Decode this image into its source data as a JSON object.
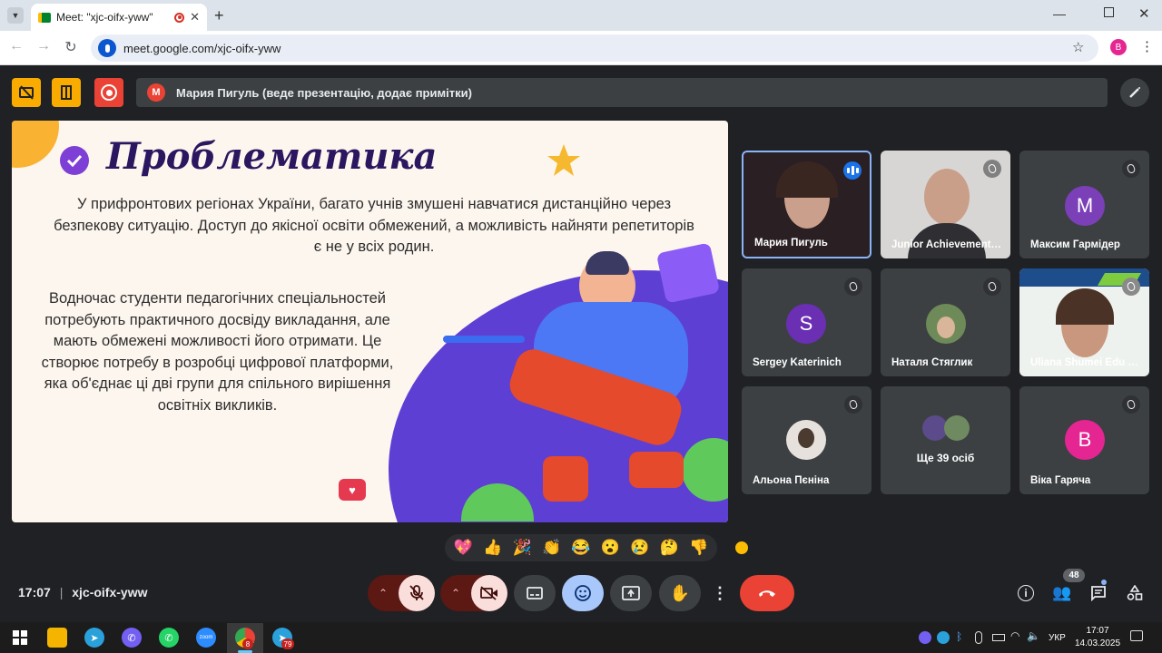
{
  "browser": {
    "tab_title": "Meet: \"xjc-oifx-yww\"",
    "url": "meet.google.com/xjc-oifx-yww",
    "profile_initial": "B"
  },
  "meet": {
    "presenter_initial": "M",
    "presenter_banner": "Мария Пигуль (веде презентацію, додає примітки)",
    "time": "17:07",
    "separator": "|",
    "meeting_code": "xjc-oifx-yww",
    "people_count": "48"
  },
  "slide": {
    "title": "Проблематика",
    "paragraph1": "У прифронтових регіонах України, багато учнів змушені навчатися дистанційно через безпекову ситуацію. Доступ до якісної освіти обмежений, а можливість найняти репетиторів є не у всіх родин.",
    "paragraph2": "Водночас студенти педагогічних спеціальностей потребують практичного досвіду викладання, але мають обмежені можливості його отримати. Це створює потребу в розробці цифрової платформи, яка об'єднає ці дві групи для спільного вирішення освітніх викликів."
  },
  "participants": [
    {
      "name": "Мария Пигуль",
      "type": "video",
      "speaking": true
    },
    {
      "name": "Junior Achievement Ukraine",
      "type": "video",
      "muted": true
    },
    {
      "name": "Максим Гармідер",
      "type": "avatar",
      "initial": "M",
      "color": "#7b3fb8",
      "muted": true
    },
    {
      "name": "Sergey Katerinich",
      "type": "avatar",
      "initial": "S",
      "color": "#6a2fb3",
      "muted": true
    },
    {
      "name": "Наталя Стяглик",
      "type": "photo",
      "muted": true
    },
    {
      "name": "Uliana Shumei Edu Hub",
      "type": "video",
      "muted": true
    },
    {
      "name": "Альона Пєніна",
      "type": "photo",
      "muted": true
    },
    {
      "name": "Ще 39 осіб",
      "type": "others"
    },
    {
      "name": "Віка Гаряча",
      "type": "avatar",
      "initial": "B",
      "color": "#e52592",
      "muted": true
    }
  ],
  "reactions": [
    "💖",
    "👍",
    "🎉",
    "👏",
    "😂",
    "😮",
    "😢",
    "🤔",
    "👎"
  ],
  "taskbar": {
    "time": "17:07",
    "date": "14.03.2025",
    "language": "УКР",
    "chrome_badge": "8",
    "telegram_badge": "79"
  },
  "colors": {
    "accent_yellow": "#f9ab00",
    "danger_red": "#ea4335",
    "end_call": "#ea4335",
    "meet_bg": "#202124",
    "tile_bg": "#3c4043",
    "slide_purple": "#5d3fd3"
  }
}
